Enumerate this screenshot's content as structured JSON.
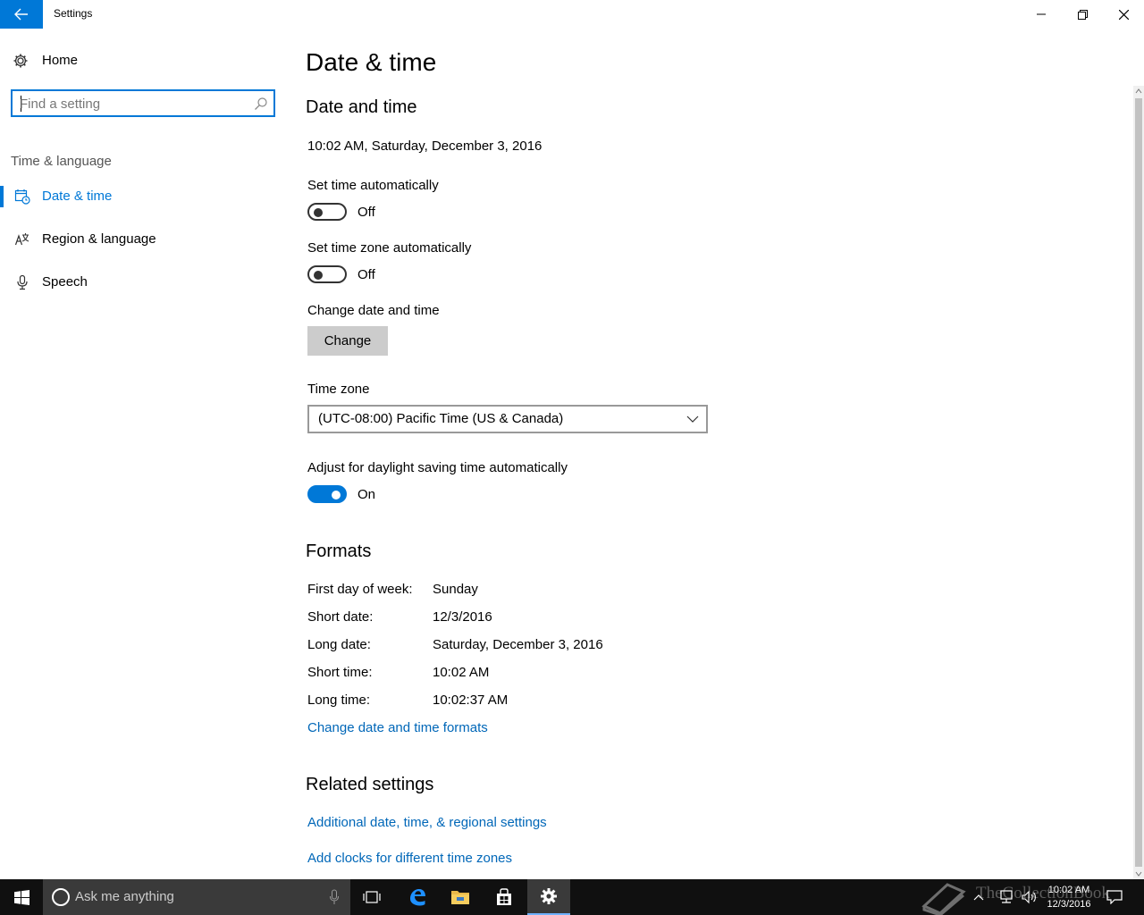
{
  "window": {
    "title": "Settings"
  },
  "sidebar": {
    "home_label": "Home",
    "search_placeholder": "Find a setting",
    "group_label": "Time & language",
    "items": [
      {
        "label": "Date & time",
        "icon": "calendar-clock-icon",
        "active": true
      },
      {
        "label": "Region & language",
        "icon": "region-language-icon",
        "active": false
      },
      {
        "label": "Speech",
        "icon": "microphone-icon",
        "active": false
      }
    ]
  },
  "main": {
    "page_title": "Date & time",
    "date_time_section_title": "Date and time",
    "current_datetime": "10:02 AM, Saturday, December 3, 2016",
    "set_time_auto": {
      "label": "Set time automatically",
      "state": "Off"
    },
    "set_timezone_auto": {
      "label": "Set time zone automatically",
      "state": "Off"
    },
    "change_date_time": {
      "label": "Change date and time",
      "button": "Change"
    },
    "time_zone": {
      "label": "Time zone",
      "value": "(UTC-08:00) Pacific Time (US & Canada)"
    },
    "daylight_saving": {
      "label": "Adjust for daylight saving time automatically",
      "state": "On"
    },
    "formats": {
      "title": "Formats",
      "rows": [
        {
          "key": "First day of week:",
          "value": "Sunday"
        },
        {
          "key": "Short date:",
          "value": "12/3/2016"
        },
        {
          "key": "Long date:",
          "value": "Saturday, December 3, 2016"
        },
        {
          "key": "Short time:",
          "value": "10:02 AM"
        },
        {
          "key": "Long time:",
          "value": "10:02:37 AM"
        }
      ],
      "change_link": "Change date and time formats"
    },
    "related": {
      "title": "Related settings",
      "links": [
        "Additional date, time, & regional settings",
        "Add clocks for different time zones"
      ]
    }
  },
  "taskbar": {
    "search_placeholder": "Ask me anything",
    "clock_time": "10:02 AM",
    "clock_date": "12/3/2016",
    "watermark": "TheCollectionBook"
  },
  "colors": {
    "accent": "#0078d7",
    "link": "#0067b8",
    "taskbar": "#101010"
  }
}
